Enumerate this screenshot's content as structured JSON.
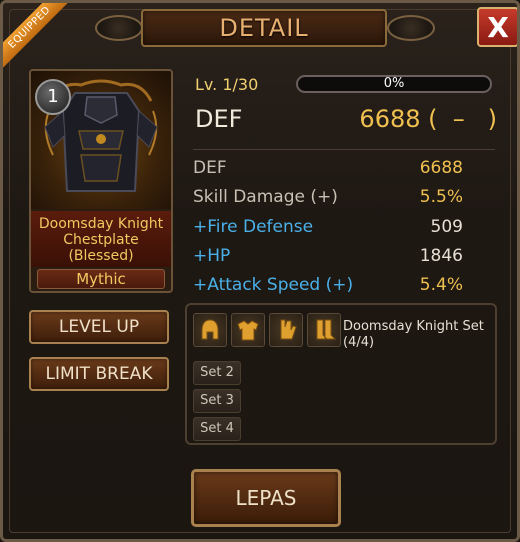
{
  "header": {
    "title": "DETAIL",
    "close_label": "X"
  },
  "ribbon": {
    "label": "EQUIPPED"
  },
  "item": {
    "level_badge": "1",
    "name_line1": "Doomsday Knight",
    "name_line2": "Chestplate",
    "name_line3": "(Blessed)",
    "rarity": "Mythic"
  },
  "buttons": {
    "level_up": "LEVEL UP",
    "limit_break": "LIMIT BREAK",
    "lepas": "LEPAS"
  },
  "progress": {
    "level_text": "Lv. 1/30",
    "percent_label": "0%",
    "fraction": 0
  },
  "main_stat": {
    "label": "DEF",
    "value": "6688 (  –   )"
  },
  "stats": [
    {
      "label": "DEF",
      "value": "6688"
    },
    {
      "label": "Skill Damage (+)",
      "value": "5.5%"
    },
    {
      "label": "+Fire Defense",
      "value": "509"
    },
    {
      "label": "+HP",
      "value": "1846"
    },
    {
      "label": "+Attack Speed (+)",
      "value": "5.4%"
    }
  ],
  "set": {
    "name": "Doomsday Knight Set (4/4)",
    "icons": [
      "helmet-icon",
      "armor-icon",
      "gloves-icon",
      "boots-icon"
    ],
    "tags": [
      "Set 2",
      "Set 3",
      "Set 4"
    ]
  },
  "colors": {
    "gold": "#f0c050",
    "blue": "#4ab0e8",
    "close_red": "#c53a2a"
  }
}
